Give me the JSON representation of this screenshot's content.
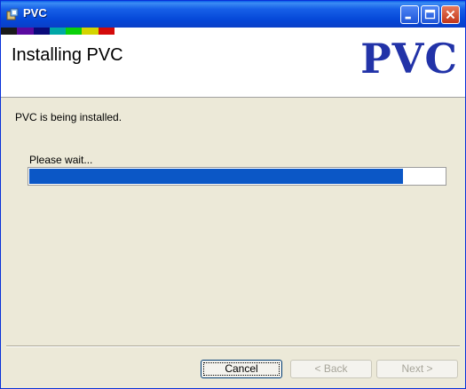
{
  "window": {
    "title": "PVC",
    "app_icon": "installer-icon",
    "controls": [
      "minimize",
      "maximize",
      "close"
    ]
  },
  "header": {
    "title": "Installing PVC",
    "logo_text": "PVC",
    "color_strip": [
      "#1a1a1a",
      "#5a0aa0",
      "#0a0a7a",
      "#00a7a7",
      "#0ad00a",
      "#d4d400",
      "#d40a0a"
    ]
  },
  "body": {
    "status_text": "PVC is being installed.",
    "wait_label": "Please wait...",
    "progress_fraction": 0.9
  },
  "buttons": {
    "cancel": "Cancel",
    "back": "< Back",
    "next": "Next >"
  },
  "colors": {
    "title_bar": "#0548d8",
    "progress_fill": "#0b57c6",
    "logo": "#2233a8",
    "dialog_bg": "#ece9d8"
  }
}
